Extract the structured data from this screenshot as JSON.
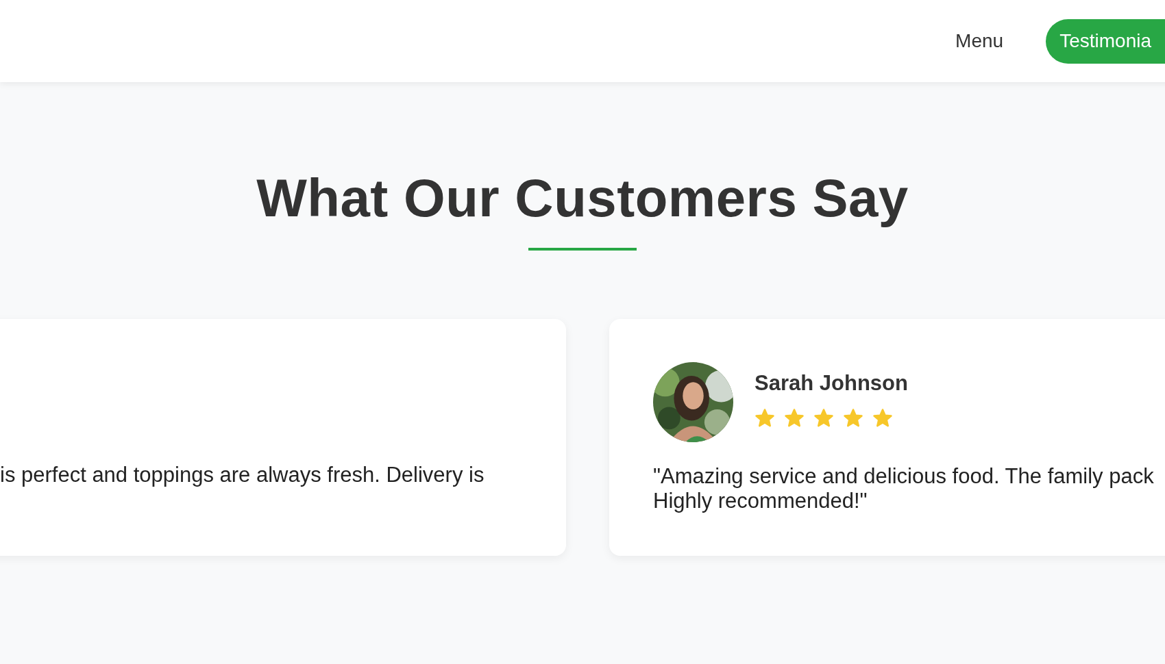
{
  "nav": {
    "links": [
      {
        "label": "Menu",
        "selected": false
      },
      {
        "label": "Testimonia",
        "selected": true
      }
    ]
  },
  "section": {
    "title": "What Our Customers Say"
  },
  "testimonials": [
    {
      "quote_lines": [
        "is perfect and toppings are always fresh. Delivery is"
      ]
    },
    {
      "name": "Sarah Johnson",
      "stars": 5,
      "quote_lines": [
        "\"Amazing service and delicious food. The family pack",
        "Highly recommended!\""
      ]
    }
  ]
}
